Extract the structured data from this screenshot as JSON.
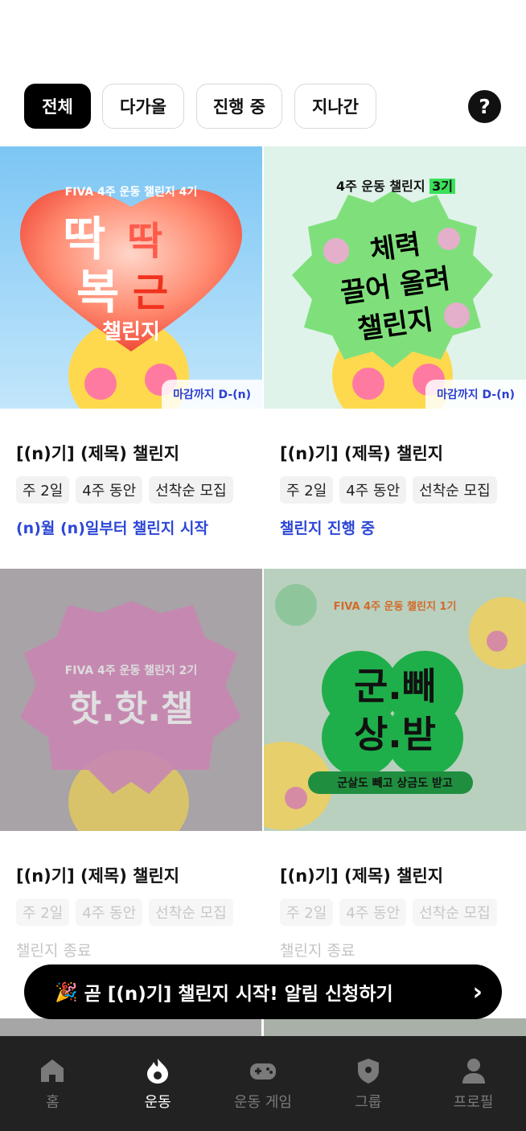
{
  "filters": [
    {
      "label": "전체",
      "active": true
    },
    {
      "label": "다가올",
      "active": false
    },
    {
      "label": "진행 중",
      "active": false
    },
    {
      "label": "지나간",
      "active": false
    }
  ],
  "help_label": "?",
  "cards": [
    {
      "art": {
        "line1": "FIVA 4주 운동 챌린지 4기",
        "big1": "딱",
        "big2": "딱",
        "big3": "복",
        "big4": "근",
        "sub": "챌린지"
      },
      "dday": "마감까지 D-(n)",
      "title": "[(n)기] (제목) 챌린지",
      "tags": [
        "주 2일",
        "4주 동안",
        "선착순 모집"
      ],
      "status": "(n)월 (n)일부터 챌린지 시작"
    },
    {
      "art": {
        "line1": "4주 운동 챌린지",
        "line1_highlight": "3기",
        "big1": "체력",
        "big2": "끌어 올려",
        "big3": "챌린지"
      },
      "dday": "마감까지 D-(n)",
      "title": "[(n)기] (제목) 챌린지",
      "tags": [
        "주 2일",
        "4주 동안",
        "선착순 모집"
      ],
      "status": "챌린지 진행 중"
    },
    {
      "art": {
        "line1": "FIVA 4주 운동 챌린지 2기",
        "big1": "핫.핫.챌"
      },
      "title": "[(n)기] (제목) 챌린지",
      "tags": [
        "주 2일",
        "4주 동안",
        "선착순 모집"
      ],
      "status": "챌린지 종료"
    },
    {
      "art": {
        "line1": "FIVA 4주 운동 챌린지 1기",
        "big1": "군.빼",
        "big2": "상.받",
        "sub": "군살도 빼고 상금도 받고"
      },
      "title": "[(n)기] (제목) 챌린지",
      "tags": [
        "주 2일",
        "4주 동안",
        "선착순 모집"
      ],
      "status": "챌린지 종료"
    }
  ],
  "banner": {
    "text": "곧 [(n)기] 챌린지 시작! 알림 신청하기",
    "party_icon": "🎉",
    "chevron": "›"
  },
  "nav": [
    {
      "label": "홈",
      "icon": "home-icon",
      "active": false
    },
    {
      "label": "운동",
      "icon": "flame-icon",
      "active": true
    },
    {
      "label": "운동 게임",
      "icon": "gamepad-icon",
      "active": false
    },
    {
      "label": "그룹",
      "icon": "shield-icon",
      "active": false
    },
    {
      "label": "프로필",
      "icon": "person-icon",
      "active": false
    }
  ],
  "colors": {
    "accent_blue": "#2d47d6",
    "nav_bg": "#222222"
  }
}
